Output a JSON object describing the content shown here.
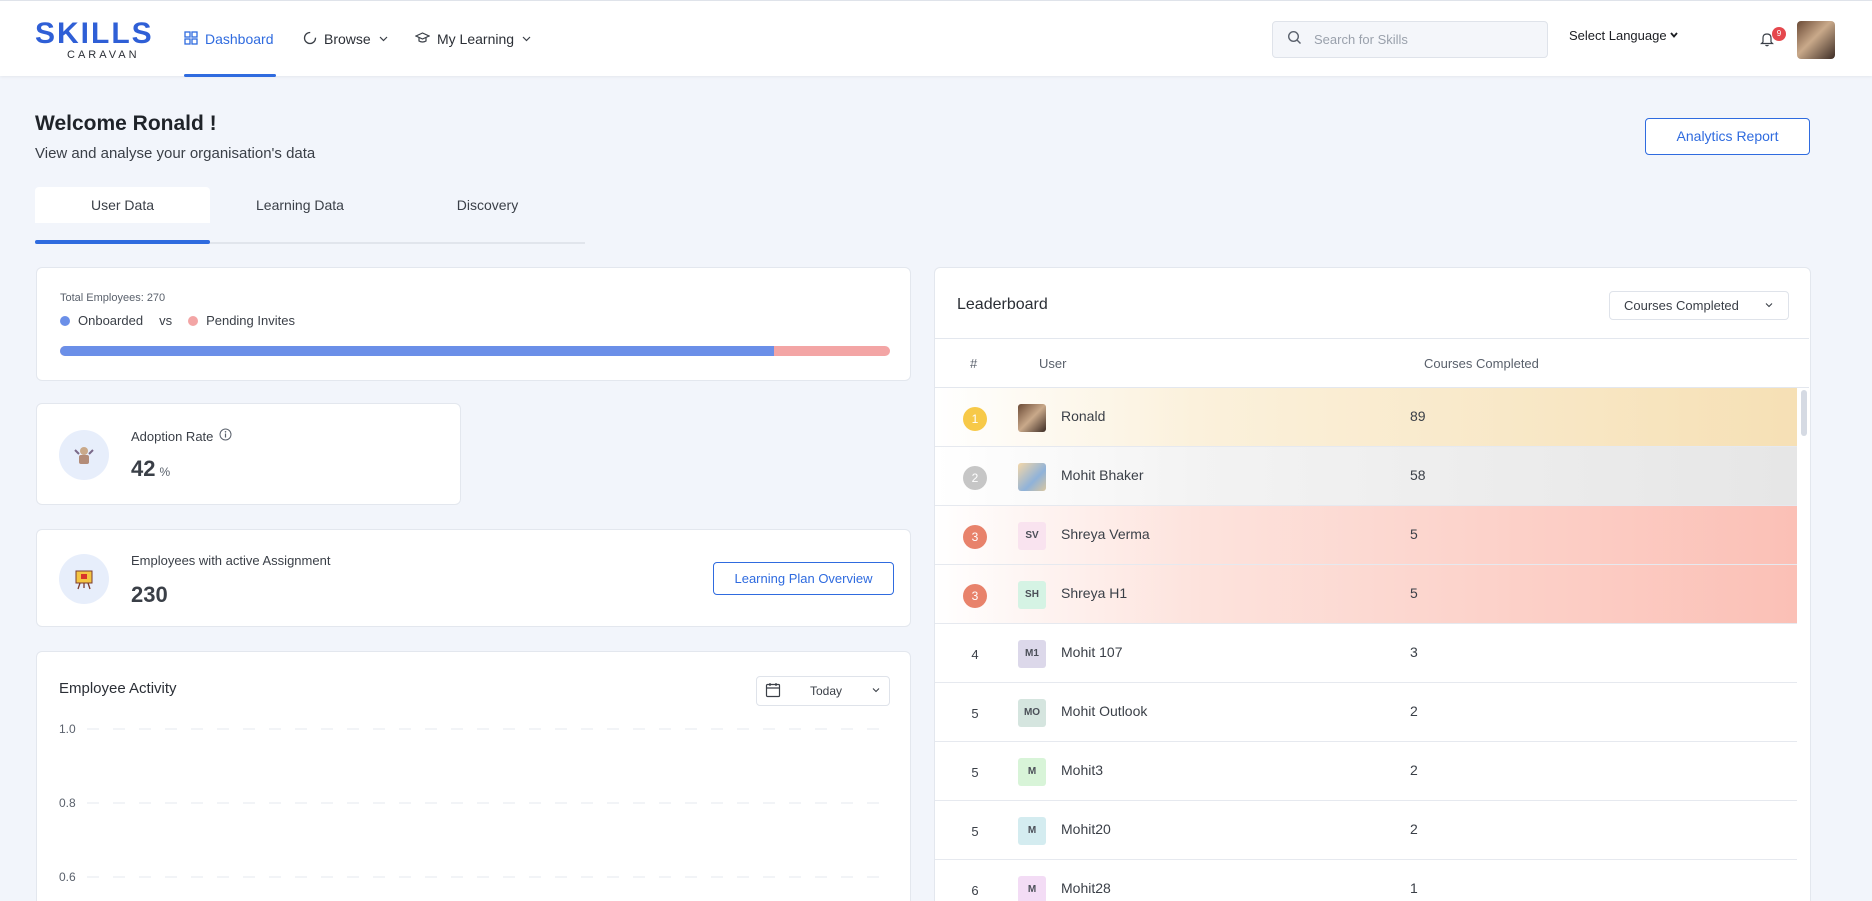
{
  "header": {
    "logo_top": "SKILLS",
    "logo_bottom": "CARAVAN",
    "nav": {
      "dashboard": "Dashboard",
      "browse": "Browse",
      "my_learning": "My Learning"
    },
    "search_placeholder": "Search for Skills",
    "language": "Select Language",
    "notifications_count": "9"
  },
  "welcome": {
    "title": "Welcome Ronald !",
    "subtitle": "View and analyse your organisation's data",
    "analytics_button": "Analytics Report"
  },
  "tabs": [
    "User Data",
    "Learning Data",
    "Discovery"
  ],
  "employees": {
    "total_label": "Total Employees: 270",
    "onboarded": "Onboarded",
    "vs": "vs",
    "pending": "Pending Invites",
    "onboarded_fraction": 0.86,
    "colors": {
      "onboarded": "#6b8fe8",
      "pending": "#f3a5a5"
    }
  },
  "adoption": {
    "label": "Adoption Rate",
    "value": "42",
    "unit": "%"
  },
  "assignment": {
    "label": "Employees with active Assignment",
    "value": "230",
    "button": "Learning Plan Overview"
  },
  "activity": {
    "title": "Employee Activity",
    "period": "Today"
  },
  "chart_data": {
    "type": "line",
    "title": "Employee Activity",
    "y_ticks": [
      "1.0",
      "0.8",
      "0.6"
    ],
    "ylim": [
      0.6,
      1.0
    ],
    "grid": true,
    "series": []
  },
  "leaderboard": {
    "title": "Leaderboard",
    "filter": "Courses Completed",
    "columns": {
      "rank": "#",
      "user": "User",
      "count": "Courses Completed"
    },
    "rows": [
      {
        "rank": "1",
        "name": "Ronald",
        "initials": "",
        "count": "89",
        "medal": "gold"
      },
      {
        "rank": "2",
        "name": "Mohit Bhaker",
        "initials": "",
        "count": "58",
        "medal": "silver"
      },
      {
        "rank": "3",
        "name": "Shreya Verma",
        "initials": "SV",
        "count": "5",
        "medal": "bronze"
      },
      {
        "rank": "3",
        "name": "Shreya H1",
        "initials": "SH",
        "count": "5",
        "medal": "bronze"
      },
      {
        "rank": "4",
        "name": "Mohit 107",
        "initials": "M1",
        "count": "3",
        "medal": ""
      },
      {
        "rank": "5",
        "name": "Mohit Outlook",
        "initials": "MO",
        "count": "2",
        "medal": ""
      },
      {
        "rank": "5",
        "name": "Mohit3",
        "initials": "M",
        "count": "2",
        "medal": ""
      },
      {
        "rank": "5",
        "name": "Mohit20",
        "initials": "M",
        "count": "2",
        "medal": ""
      },
      {
        "rank": "6",
        "name": "Mohit28",
        "initials": "M",
        "count": "1",
        "medal": ""
      }
    ]
  },
  "colors": {
    "accent": "#2f6bdf",
    "gold_row": "#f6e3bf",
    "silver_row": "#e8e8e8",
    "bronze_row": "#fbc3bb"
  }
}
